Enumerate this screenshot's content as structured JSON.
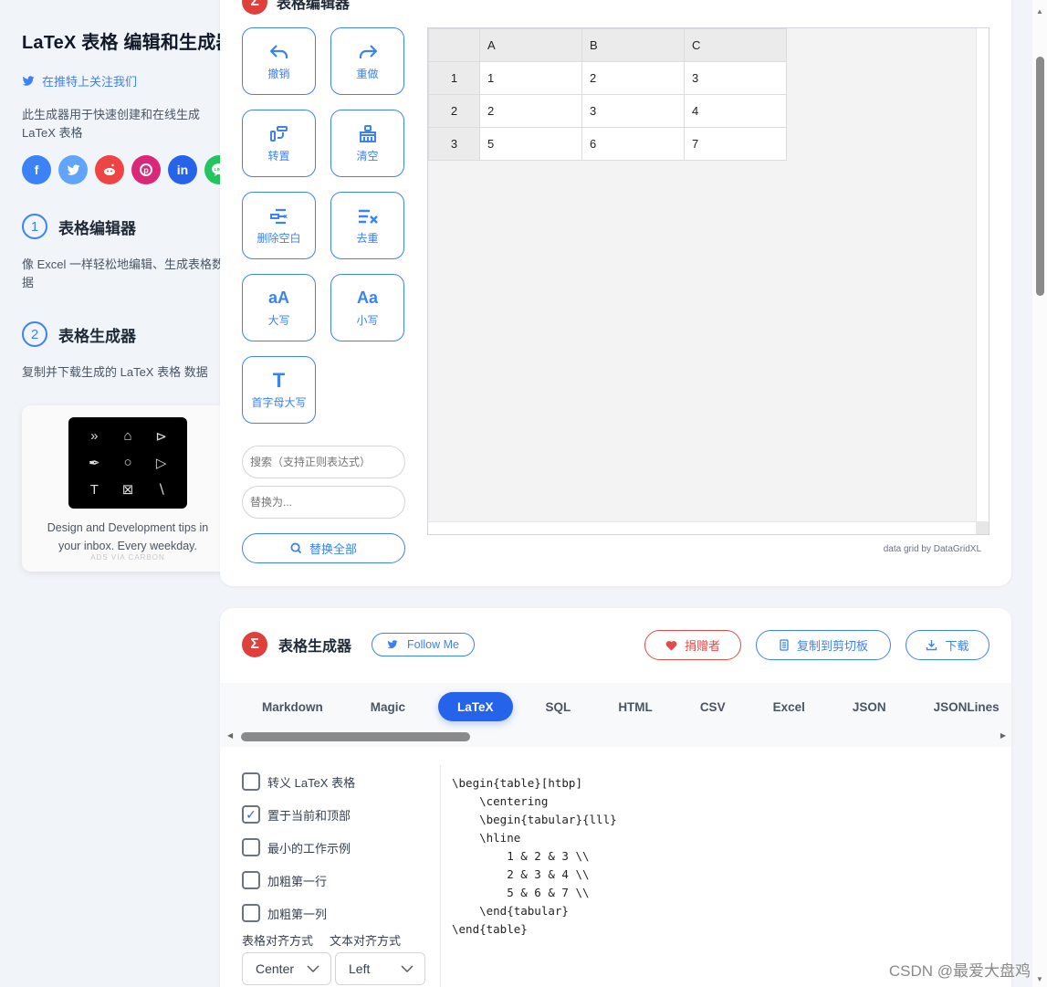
{
  "sidebar": {
    "title": "LaTeX 表格 编辑和生成器",
    "twitter_link": "在推特上关注我们",
    "description": "此生成器用于快速创建和在线生成 LaTeX 表格",
    "social": [
      {
        "name": "facebook",
        "glyph": "f",
        "color": "#3b82f6"
      },
      {
        "name": "twitter",
        "glyph": "🐦",
        "color": "#60a5fa"
      },
      {
        "name": "reddit",
        "glyph": "●",
        "color": "#ef4444"
      },
      {
        "name": "pinterest",
        "glyph": "P",
        "color": "#db2777"
      },
      {
        "name": "linkedin",
        "glyph": "in",
        "color": "#2563eb"
      },
      {
        "name": "line",
        "glyph": "LINE",
        "color": "#22c55e"
      }
    ],
    "steps": [
      {
        "num": "1",
        "title": "表格编辑器",
        "desc": "像 Excel 一样轻松地编辑、生成表格数据"
      },
      {
        "num": "2",
        "title": "表格生成器",
        "desc": "复制并下载生成的 LaTeX 表格 数据"
      }
    ],
    "ad": {
      "text": "Design and Development tips in your inbox. Every weekday.",
      "via": "ADS VIA CARBON",
      "icons": [
        "»",
        "⌂",
        "⊳",
        "✒",
        "○",
        "▷",
        "T",
        "⊠",
        "∖"
      ]
    }
  },
  "editor": {
    "title": "表格编辑器",
    "tools": [
      {
        "name": "undo",
        "label": "撤销",
        "icon": "↶"
      },
      {
        "name": "redo",
        "label": "重做",
        "icon": "↷"
      },
      {
        "name": "transpose",
        "label": "转置",
        "icon": "⇄"
      },
      {
        "name": "clear",
        "label": "清空",
        "icon": "⌧"
      },
      {
        "name": "remove-blank",
        "label": "删除空白",
        "icon": "☰"
      },
      {
        "name": "dedupe",
        "label": "去重",
        "icon": "≡×"
      },
      {
        "name": "uppercase",
        "label": "大写",
        "icon": "aA"
      },
      {
        "name": "lowercase",
        "label": "小写",
        "icon": "Aa"
      },
      {
        "name": "capitalize",
        "label": "首字母大写",
        "icon": "T"
      }
    ],
    "search_placeholder": "搜索（支持正则表达式）",
    "replace_placeholder": "替换为...",
    "replace_all_label": "替换全部",
    "grid": {
      "columns": [
        "A",
        "B",
        "C"
      ],
      "rows": [
        {
          "header": "1",
          "cells": [
            "1",
            "2",
            "3"
          ]
        },
        {
          "header": "2",
          "cells": [
            "2",
            "3",
            "4"
          ]
        },
        {
          "header": "3",
          "cells": [
            "5",
            "6",
            "7"
          ]
        }
      ]
    },
    "credit": "data grid by DataGridXL"
  },
  "generator": {
    "title": "表格生成器",
    "follow_label": "Follow Me",
    "donate_label": "捐赠者",
    "copy_label": "复制到剪切板",
    "download_label": "下载",
    "tabs": [
      "Markdown",
      "Magic",
      "LaTeX",
      "SQL",
      "HTML",
      "CSV",
      "Excel",
      "JSON",
      "JSONLines"
    ],
    "active_tab": "LaTeX",
    "options": [
      {
        "label": "转义 LaTeX 表格",
        "checked": false
      },
      {
        "label": "置于当前和顶部",
        "checked": true
      },
      {
        "label": "最小的工作示例",
        "checked": false
      },
      {
        "label": "加粗第一行",
        "checked": false
      },
      {
        "label": "加粗第一列",
        "checked": false
      }
    ],
    "table_align_label": "表格对齐方式",
    "text_align_label": "文本对齐方式",
    "table_align_value": "Center",
    "text_align_value": "Left",
    "code": "\\begin{table}[htbp]\n    \\centering\n    \\begin{tabular}{lll}\n    \\hline\n        1 & 2 & 3 \\\\\n        2 & 3 & 4 \\\\\n        5 & 6 & 7 \\\\\n    \\end{tabular}\n\\end{table}"
  },
  "watermark": "CSDN @最爱大盘鸡",
  "colors": {
    "accent": "#3b82f6",
    "active_tab": "#2563eb",
    "danger": "#e04b4b",
    "sigma": "#e0403b"
  }
}
